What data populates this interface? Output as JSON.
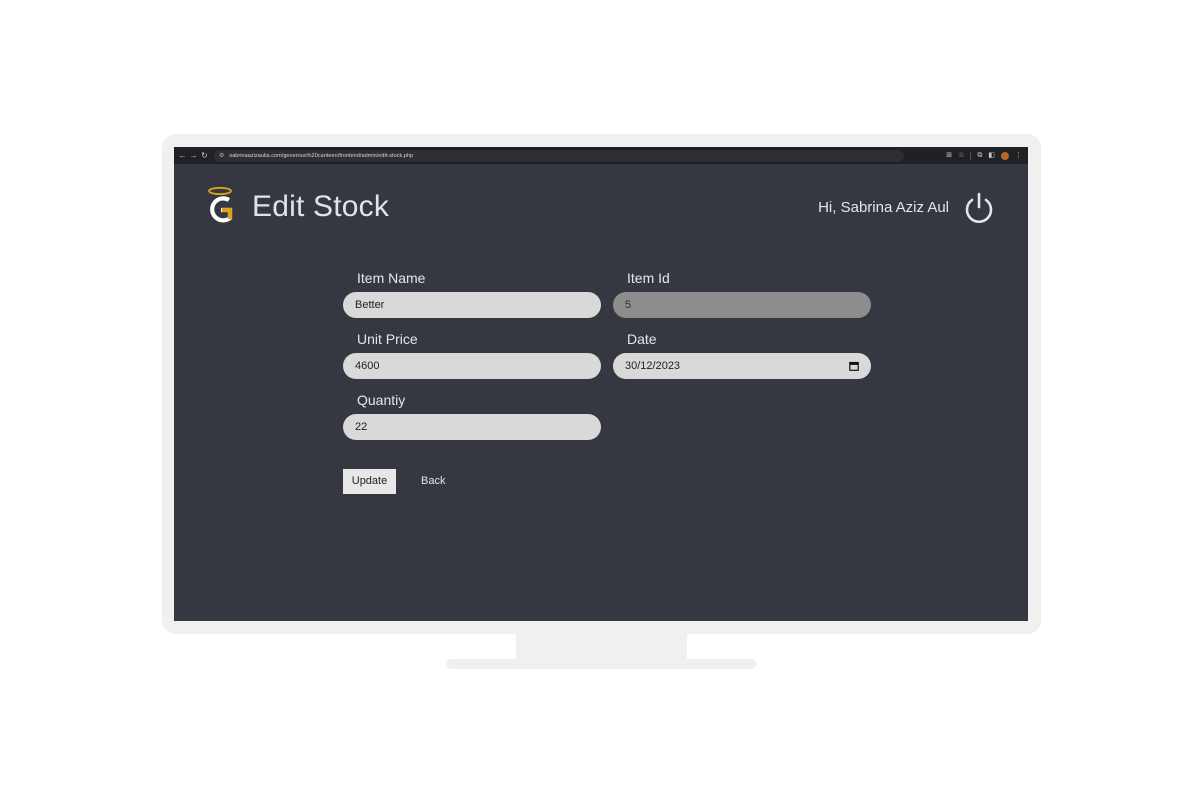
{
  "browser": {
    "url": "sabrinaazizaulia.com/generous%20canteen/frontend/admin/edit-stock.php",
    "icons": [
      "back-arrow-icon",
      "forward-arrow-icon",
      "reload-icon",
      "site-settings-icon",
      "translate-icon",
      "bookmark-star-icon",
      "extensions-icon",
      "side-panel-icon",
      "profile-avatar-icon",
      "menu-dots-icon"
    ]
  },
  "header": {
    "title": "Edit Stock",
    "greeting": "Hi, Sabrina Aziz Aul",
    "logo_color": "#e0a21c",
    "logo_letter_color": "#ffffff"
  },
  "form": {
    "item_name": {
      "label": "Item Name",
      "value": "Better"
    },
    "item_id": {
      "label": "Item Id",
      "value": "5"
    },
    "unit_price": {
      "label": "Unit Price",
      "value": "4600"
    },
    "date": {
      "label": "Date",
      "value": "30/12/2023"
    },
    "quantity": {
      "label": "Quantiy",
      "value": "22"
    },
    "update_label": "Update",
    "back_label": "Back"
  },
  "colors": {
    "background": "#353841",
    "input": "#d9d9d9",
    "input_disabled": "#8d8d8d"
  }
}
